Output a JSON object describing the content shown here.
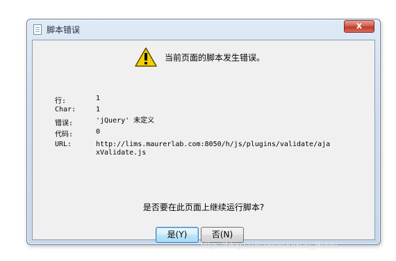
{
  "window": {
    "title": "脚本错误",
    "close_label": "x"
  },
  "dialog": {
    "heading": "当前页面的脚本发生错误。",
    "icon": "warning-icon",
    "details": [
      {
        "label": "行:",
        "value": "1"
      },
      {
        "label": "Char:",
        "value": "1"
      },
      {
        "label": "错误:",
        "value": "'jQuery' 未定义"
      },
      {
        "label": "代码:",
        "value": "0"
      },
      {
        "label": "URL:",
        "value": "http://lims.maurerlab.com:8050/h/js/plugins/validate/ajaxValidate.js"
      }
    ],
    "question": "是否要在此页面上继续运行脚本?",
    "yes_label": "是(Y)",
    "no_label": "否(N)"
  },
  "watermark": "https://blog.csdn.net/xiao/xiao_Rehle",
  "colors": {
    "accent": "#3c7fb1",
    "close_button": "#c0392b",
    "warning": "#f5d000"
  }
}
